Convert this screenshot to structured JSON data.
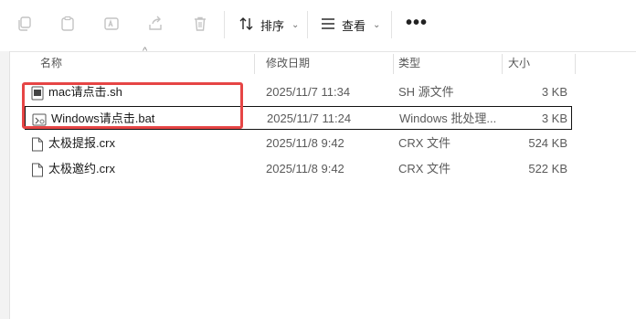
{
  "toolbar": {
    "sort_label": "排序",
    "view_label": "查看",
    "more_label": "•••"
  },
  "columns": {
    "name": "名称",
    "date": "修改日期",
    "type": "类型",
    "size": "大小"
  },
  "files": [
    {
      "name": "mac请点击.sh",
      "date": "2025/11/7 11:34",
      "type": "SH 源文件",
      "size": "3 KB",
      "icon": "script-file-icon"
    },
    {
      "name": "Windows请点击.bat",
      "date": "2025/11/7 11:24",
      "type": "Windows 批处理...",
      "size": "3 KB",
      "icon": "batch-file-icon"
    },
    {
      "name": "太极提报.crx",
      "date": "2025/11/8 9:42",
      "type": "CRX 文件",
      "size": "524 KB",
      "icon": "file-icon"
    },
    {
      "name": "太极邀约.crx",
      "date": "2025/11/8 9:42",
      "type": "CRX 文件",
      "size": "522 KB",
      "icon": "file-icon"
    }
  ],
  "colors": {
    "highlight": "#e64545",
    "disabled_icon": "#c3c3c3"
  }
}
